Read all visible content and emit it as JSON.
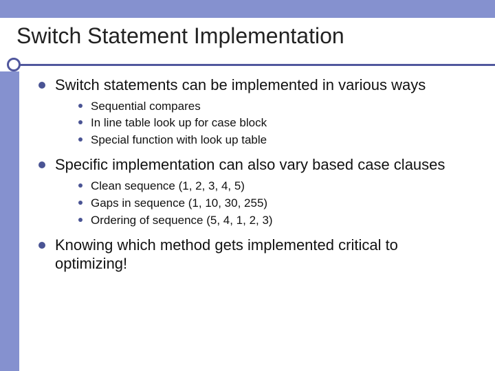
{
  "slide": {
    "title": "Switch Statement Implementation",
    "bullets": [
      {
        "text": "Switch statements can be implemented in various ways",
        "children": [
          {
            "text": "Sequential compares"
          },
          {
            "text": "In line table look up for case block"
          },
          {
            "text": "Special function with look up table"
          }
        ]
      },
      {
        "text": "Specific implementation can also vary based case clauses",
        "children": [
          {
            "text": "Clean sequence (1, 2, 3, 4, 5)"
          },
          {
            "text": "Gaps in sequence (1, 10, 30, 255)"
          },
          {
            "text": "Ordering of sequence (5, 4, 1, 2, 3)"
          }
        ]
      },
      {
        "text": "Knowing which method gets implemented critical to optimizing!",
        "children": []
      }
    ]
  },
  "theme": {
    "band_color": "#8591cf",
    "accent_color": "#50579d"
  }
}
